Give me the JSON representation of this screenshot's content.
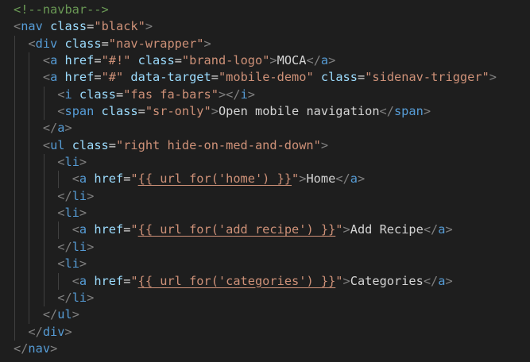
{
  "colors": {
    "background": "#1e1e1e",
    "comment": "#6a9955",
    "punctuation": "#808080",
    "tag": "#569cd6",
    "attribute": "#9cdcfe",
    "string": "#ce9178",
    "text": "#d4d4d4",
    "indent_guide": "#404040"
  },
  "lines": [
    {
      "indent": 0,
      "tokens": [
        {
          "t": "comment",
          "v": "<!--navbar-->"
        }
      ]
    },
    {
      "indent": 0,
      "tokens": [
        {
          "t": "punct",
          "v": "<"
        },
        {
          "t": "tag",
          "v": "nav"
        },
        {
          "t": "text",
          "v": " "
        },
        {
          "t": "attr",
          "v": "class"
        },
        {
          "t": "eq",
          "v": "="
        },
        {
          "t": "str",
          "v": "\"black\""
        },
        {
          "t": "punct",
          "v": ">"
        }
      ]
    },
    {
      "indent": 1,
      "tokens": [
        {
          "t": "punct",
          "v": "<"
        },
        {
          "t": "tag",
          "v": "div"
        },
        {
          "t": "text",
          "v": " "
        },
        {
          "t": "attr",
          "v": "class"
        },
        {
          "t": "eq",
          "v": "="
        },
        {
          "t": "str",
          "v": "\"nav-wrapper\""
        },
        {
          "t": "punct",
          "v": ">"
        }
      ]
    },
    {
      "indent": 2,
      "tokens": [
        {
          "t": "punct",
          "v": "<"
        },
        {
          "t": "tag",
          "v": "a"
        },
        {
          "t": "text",
          "v": " "
        },
        {
          "t": "attr",
          "v": "href"
        },
        {
          "t": "eq",
          "v": "="
        },
        {
          "t": "str",
          "v": "\"#!\""
        },
        {
          "t": "text",
          "v": " "
        },
        {
          "t": "attr",
          "v": "class"
        },
        {
          "t": "eq",
          "v": "="
        },
        {
          "t": "str",
          "v": "\"brand-logo\""
        },
        {
          "t": "punct",
          "v": ">"
        },
        {
          "t": "text",
          "v": "MOCA"
        },
        {
          "t": "punct",
          "v": "</"
        },
        {
          "t": "tag",
          "v": "a"
        },
        {
          "t": "punct",
          "v": ">"
        }
      ]
    },
    {
      "indent": 2,
      "tokens": [
        {
          "t": "punct",
          "v": "<"
        },
        {
          "t": "tag",
          "v": "a"
        },
        {
          "t": "text",
          "v": " "
        },
        {
          "t": "attr",
          "v": "href"
        },
        {
          "t": "eq",
          "v": "="
        },
        {
          "t": "str",
          "v": "\"#\""
        },
        {
          "t": "text",
          "v": " "
        },
        {
          "t": "attr",
          "v": "data-target"
        },
        {
          "t": "eq",
          "v": "="
        },
        {
          "t": "str",
          "v": "\"mobile-demo\""
        },
        {
          "t": "text",
          "v": " "
        },
        {
          "t": "attr",
          "v": "class"
        },
        {
          "t": "eq",
          "v": "="
        },
        {
          "t": "str",
          "v": "\"sidenav-trigger\""
        },
        {
          "t": "punct",
          "v": ">"
        }
      ]
    },
    {
      "indent": 3,
      "tokens": [
        {
          "t": "punct",
          "v": "<"
        },
        {
          "t": "tag",
          "v": "i"
        },
        {
          "t": "text",
          "v": " "
        },
        {
          "t": "attr",
          "v": "class"
        },
        {
          "t": "eq",
          "v": "="
        },
        {
          "t": "str",
          "v": "\"fas fa-bars\""
        },
        {
          "t": "punct",
          "v": "></"
        },
        {
          "t": "tag",
          "v": "i"
        },
        {
          "t": "punct",
          "v": ">"
        }
      ]
    },
    {
      "indent": 3,
      "tokens": [
        {
          "t": "punct",
          "v": "<"
        },
        {
          "t": "tag",
          "v": "span"
        },
        {
          "t": "text",
          "v": " "
        },
        {
          "t": "attr",
          "v": "class"
        },
        {
          "t": "eq",
          "v": "="
        },
        {
          "t": "str",
          "v": "\"sr-only\""
        },
        {
          "t": "punct",
          "v": ">"
        },
        {
          "t": "text",
          "v": "Open mobile navigation"
        },
        {
          "t": "punct",
          "v": "</"
        },
        {
          "t": "tag",
          "v": "span"
        },
        {
          "t": "punct",
          "v": ">"
        }
      ]
    },
    {
      "indent": 2,
      "tokens": [
        {
          "t": "punct",
          "v": "</"
        },
        {
          "t": "tag",
          "v": "a"
        },
        {
          "t": "punct",
          "v": ">"
        }
      ]
    },
    {
      "indent": 2,
      "tokens": [
        {
          "t": "punct",
          "v": "<"
        },
        {
          "t": "tag",
          "v": "ul"
        },
        {
          "t": "text",
          "v": " "
        },
        {
          "t": "attr",
          "v": "class"
        },
        {
          "t": "eq",
          "v": "="
        },
        {
          "t": "str",
          "v": "\"right hide-on-med-and-down\""
        },
        {
          "t": "punct",
          "v": ">"
        }
      ]
    },
    {
      "indent": 3,
      "tokens": [
        {
          "t": "punct",
          "v": "<"
        },
        {
          "t": "tag",
          "v": "li"
        },
        {
          "t": "punct",
          "v": ">"
        }
      ]
    },
    {
      "indent": 4,
      "tokens": [
        {
          "t": "punct",
          "v": "<"
        },
        {
          "t": "tag",
          "v": "a"
        },
        {
          "t": "text",
          "v": " "
        },
        {
          "t": "attr",
          "v": "href"
        },
        {
          "t": "eq",
          "v": "="
        },
        {
          "t": "str",
          "v": "\""
        },
        {
          "t": "str",
          "v": "{{ url_for('home') }}",
          "u": true
        },
        {
          "t": "str",
          "v": "\""
        },
        {
          "t": "punct",
          "v": ">"
        },
        {
          "t": "text",
          "v": "Home"
        },
        {
          "t": "punct",
          "v": "</"
        },
        {
          "t": "tag",
          "v": "a"
        },
        {
          "t": "punct",
          "v": ">"
        }
      ]
    },
    {
      "indent": 3,
      "tokens": [
        {
          "t": "punct",
          "v": "</"
        },
        {
          "t": "tag",
          "v": "li"
        },
        {
          "t": "punct",
          "v": ">"
        }
      ]
    },
    {
      "indent": 3,
      "tokens": [
        {
          "t": "punct",
          "v": "<"
        },
        {
          "t": "tag",
          "v": "li"
        },
        {
          "t": "punct",
          "v": ">"
        }
      ]
    },
    {
      "indent": 4,
      "tokens": [
        {
          "t": "punct",
          "v": "<"
        },
        {
          "t": "tag",
          "v": "a"
        },
        {
          "t": "text",
          "v": " "
        },
        {
          "t": "attr",
          "v": "href"
        },
        {
          "t": "eq",
          "v": "="
        },
        {
          "t": "str",
          "v": "\""
        },
        {
          "t": "str",
          "v": "{{ url_for('add_recipe') }}",
          "u": true
        },
        {
          "t": "str",
          "v": "\""
        },
        {
          "t": "punct",
          "v": ">"
        },
        {
          "t": "text",
          "v": "Add Recipe"
        },
        {
          "t": "punct",
          "v": "</"
        },
        {
          "t": "tag",
          "v": "a"
        },
        {
          "t": "punct",
          "v": ">"
        }
      ]
    },
    {
      "indent": 3,
      "tokens": [
        {
          "t": "punct",
          "v": "</"
        },
        {
          "t": "tag",
          "v": "li"
        },
        {
          "t": "punct",
          "v": ">"
        }
      ]
    },
    {
      "indent": 3,
      "tokens": [
        {
          "t": "punct",
          "v": "<"
        },
        {
          "t": "tag",
          "v": "li"
        },
        {
          "t": "punct",
          "v": ">"
        }
      ]
    },
    {
      "indent": 4,
      "tokens": [
        {
          "t": "punct",
          "v": "<"
        },
        {
          "t": "tag",
          "v": "a"
        },
        {
          "t": "text",
          "v": " "
        },
        {
          "t": "attr",
          "v": "href"
        },
        {
          "t": "eq",
          "v": "="
        },
        {
          "t": "str",
          "v": "\""
        },
        {
          "t": "str",
          "v": "{{ url_for('categories') }}",
          "u": true
        },
        {
          "t": "str",
          "v": "\""
        },
        {
          "t": "punct",
          "v": ">"
        },
        {
          "t": "text",
          "v": "Categories"
        },
        {
          "t": "punct",
          "v": "</"
        },
        {
          "t": "tag",
          "v": "a"
        },
        {
          "t": "punct",
          "v": ">"
        }
      ]
    },
    {
      "indent": 3,
      "tokens": [
        {
          "t": "punct",
          "v": "</"
        },
        {
          "t": "tag",
          "v": "li"
        },
        {
          "t": "punct",
          "v": ">"
        }
      ]
    },
    {
      "indent": 2,
      "tokens": [
        {
          "t": "punct",
          "v": "</"
        },
        {
          "t": "tag",
          "v": "ul"
        },
        {
          "t": "punct",
          "v": ">"
        }
      ]
    },
    {
      "indent": 1,
      "tokens": [
        {
          "t": "punct",
          "v": "</"
        },
        {
          "t": "tag",
          "v": "div"
        },
        {
          "t": "punct",
          "v": ">"
        }
      ]
    },
    {
      "indent": 0,
      "tokens": [
        {
          "t": "punct",
          "v": "</"
        },
        {
          "t": "tag",
          "v": "nav"
        },
        {
          "t": "punct",
          "v": ">"
        }
      ]
    }
  ]
}
